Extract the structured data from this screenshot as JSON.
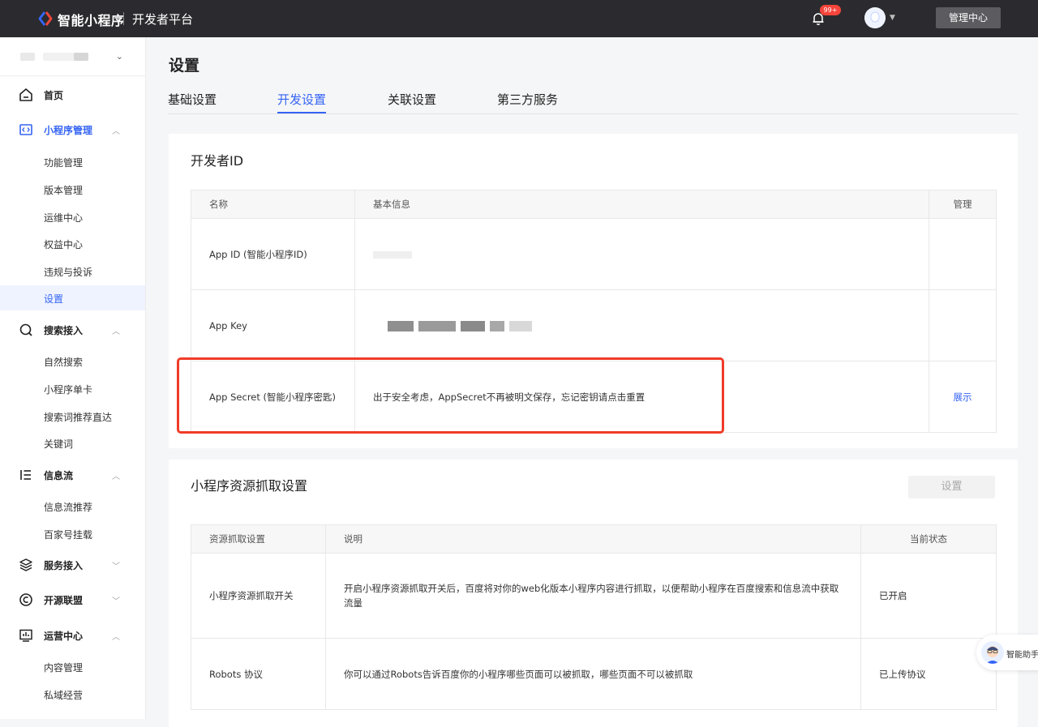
{
  "colors": {
    "accent": "#3564f4",
    "topbar": "#2b2b2f",
    "highlight": "#f03b28"
  },
  "topbar": {
    "brand": "智能小程序",
    "platform": "开发者平台",
    "badge": "99+",
    "manage_center": "管理中心"
  },
  "sidebar": {
    "groups": [
      {
        "label": "首页",
        "icon": "home-icon"
      },
      {
        "label": "小程序管理",
        "icon": "code-icon",
        "items": [
          "功能管理",
          "版本管理",
          "运维中心",
          "权益中心",
          "违规与投诉",
          "设置"
        ]
      },
      {
        "label": "搜索接入",
        "icon": "search-icon",
        "items": [
          "自然搜索",
          "小程序单卡",
          "搜索词推荐直达",
          "关键词"
        ]
      },
      {
        "label": "信息流",
        "icon": "feed-icon",
        "items": [
          "信息流推荐",
          "百家号挂载"
        ]
      },
      {
        "label": "服务接入",
        "icon": "service-icon"
      },
      {
        "label": "开源联盟",
        "icon": "open-source-icon"
      },
      {
        "label": "运营中心",
        "icon": "operation-icon",
        "items": [
          "内容管理",
          "私域经营"
        ]
      }
    ]
  },
  "page": {
    "title": "设置",
    "tabs": [
      "基础设置",
      "开发设置",
      "关联设置",
      "第三方服务"
    ]
  },
  "developer_id": {
    "title": "开发者ID",
    "headers": [
      "名称",
      "基本信息",
      "管理"
    ],
    "rows": [
      {
        "name": "App ID (智能小程序ID)",
        "info": "",
        "action": ""
      },
      {
        "name": "App Key",
        "info": "",
        "action": ""
      },
      {
        "name": "App Secret (智能小程序密匙)",
        "info": "出于安全考虑，AppSecret不再被明文保存，忘记密钥请点击重置",
        "action": "展示"
      }
    ]
  },
  "resource": {
    "title": "小程序资源抓取设置",
    "set_button": "设置",
    "headers": [
      "资源抓取设置",
      "说明",
      "当前状态"
    ],
    "rows": [
      {
        "name": "小程序资源抓取开关",
        "desc": "开启小程序资源抓取开关后，百度将对你的web化版本小程序内容进行抓取，以便帮助小程序在百度搜索和信息流中获取流量",
        "status": "已开启"
      },
      {
        "name": "Robots 协议",
        "desc": "你可以通过Robots告诉百度你的小程序哪些页面可以被抓取，哪些页面不可以被抓取",
        "status": "已上传协议"
      }
    ]
  },
  "assistant": {
    "label": "智能助手"
  }
}
